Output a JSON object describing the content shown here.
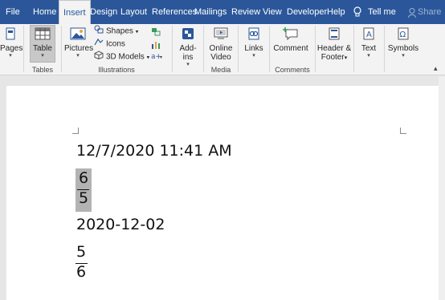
{
  "tabs": [
    "File",
    "Home",
    "Insert",
    "Design",
    "Layout",
    "References",
    "Mailings",
    "Review",
    "View",
    "Developer",
    "Help"
  ],
  "active_tab": "Insert",
  "tell_me": "Tell me",
  "share": "Share",
  "ribbon": {
    "pages": "Pages",
    "table": "Table",
    "pictures": "Pictures",
    "shapes": "Shapes",
    "icons": "Icons",
    "models": "3D Models",
    "addins_1": "Add-",
    "addins_2": "ins",
    "online_video_1": "Online",
    "online_video_2": "Video",
    "links": "Links",
    "comment": "Comment",
    "header_footer_1": "Header &",
    "header_footer_2": "Footer",
    "text": "Text",
    "symbols": "Symbols",
    "groups": {
      "tables": "Tables",
      "illustrations": "Illustrations",
      "media": "Media",
      "comments": "Comments"
    }
  },
  "document": {
    "line1": "12/7/2020 11:41 AM",
    "fraction1": {
      "numerator": "6",
      "denominator": "5"
    },
    "line3": "2020-12-02",
    "fraction2": {
      "numerator": "5",
      "denominator": "6"
    }
  },
  "colors": {
    "accent": "#2b579a",
    "selection": "#b3b3b3"
  }
}
